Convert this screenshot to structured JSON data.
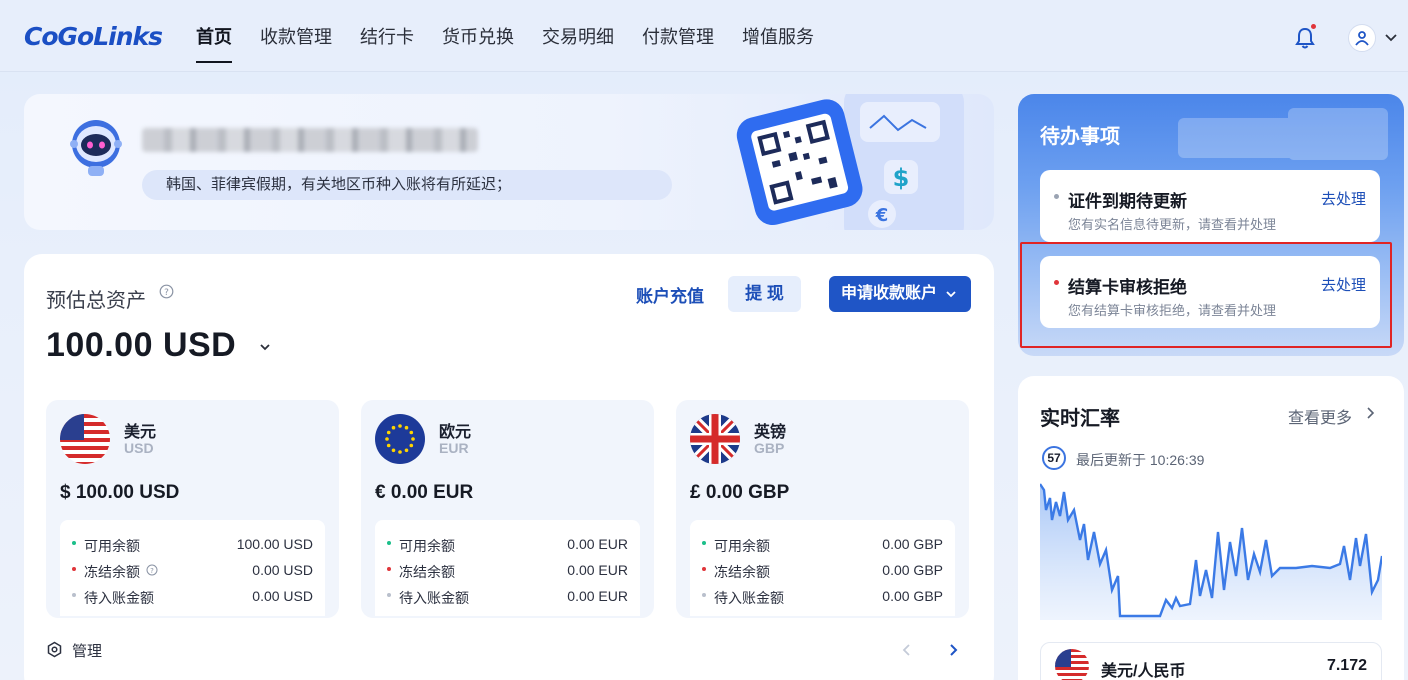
{
  "brand": {
    "logo_text": "CoGoLinks"
  },
  "nav": {
    "items": [
      "首页",
      "收款管理",
      "结行卡",
      "货币兑换",
      "交易明细",
      "付款管理",
      "增值服务"
    ],
    "active": "首页"
  },
  "header": {
    "notification_icon": "bell-icon",
    "user_icon": "user-icon"
  },
  "banner": {
    "notice": "韩国、菲律宾假期，有关地区币种入账将有所延迟；"
  },
  "assets": {
    "title": "预估总资产",
    "total": "100.00  USD",
    "recharge_label": "账户充值",
    "withdraw_label": "提 现",
    "apply_label": "申请收款账户",
    "manage_label": "管理",
    "currencies": [
      {
        "name": "美元",
        "code": "USD",
        "amount": "$ 100.00 USD",
        "rows": [
          {
            "label": "可用余额",
            "value": "100.00 USD",
            "color": "#1bbf8a"
          },
          {
            "label": "冻结余额",
            "value": "0.00 USD",
            "color": "#e0353a"
          },
          {
            "label": "待入账金额",
            "value": "0.00 USD",
            "color": "#b9c0cc"
          }
        ]
      },
      {
        "name": "欧元",
        "code": "EUR",
        "amount": "€ 0.00 EUR",
        "rows": [
          {
            "label": "可用余额",
            "value": "0.00 EUR",
            "color": "#1bbf8a"
          },
          {
            "label": "冻结余额",
            "value": "0.00 EUR",
            "color": "#e0353a"
          },
          {
            "label": "待入账金额",
            "value": "0.00 EUR",
            "color": "#b9c0cc"
          }
        ]
      },
      {
        "name": "英镑",
        "code": "GBP",
        "amount": "£  0.00 GBP",
        "rows": [
          {
            "label": "可用余额",
            "value": "0.00 GBP",
            "color": "#1bbf8a"
          },
          {
            "label": "冻结余额",
            "value": "0.00 GBP",
            "color": "#e0353a"
          },
          {
            "label": "待入账金额",
            "value": "0.00 GBP",
            "color": "#b9c0cc"
          }
        ]
      }
    ]
  },
  "todo": {
    "title": "待办事项",
    "items": [
      {
        "title": "证件到期待更新",
        "desc": "您有实名信息待更新，请查看并处理",
        "action": "去处理",
        "dot_color": "#9aa3b2"
      },
      {
        "title": "结算卡审核拒绝",
        "desc": "您有结算卡审核拒绝，请查看并处理",
        "action": "去处理",
        "dot_color": "#e0353a"
      }
    ]
  },
  "rates": {
    "title": "实时汇率",
    "more_label": "查看更多",
    "countdown": "57",
    "updated": "最后更新于 10:26:39",
    "pair": {
      "name": "美元/人民币",
      "value": "7.172"
    }
  },
  "colors": {
    "primary": "#1f55c6",
    "accent_link": "#1d4fb8",
    "danger": "#e02424"
  }
}
